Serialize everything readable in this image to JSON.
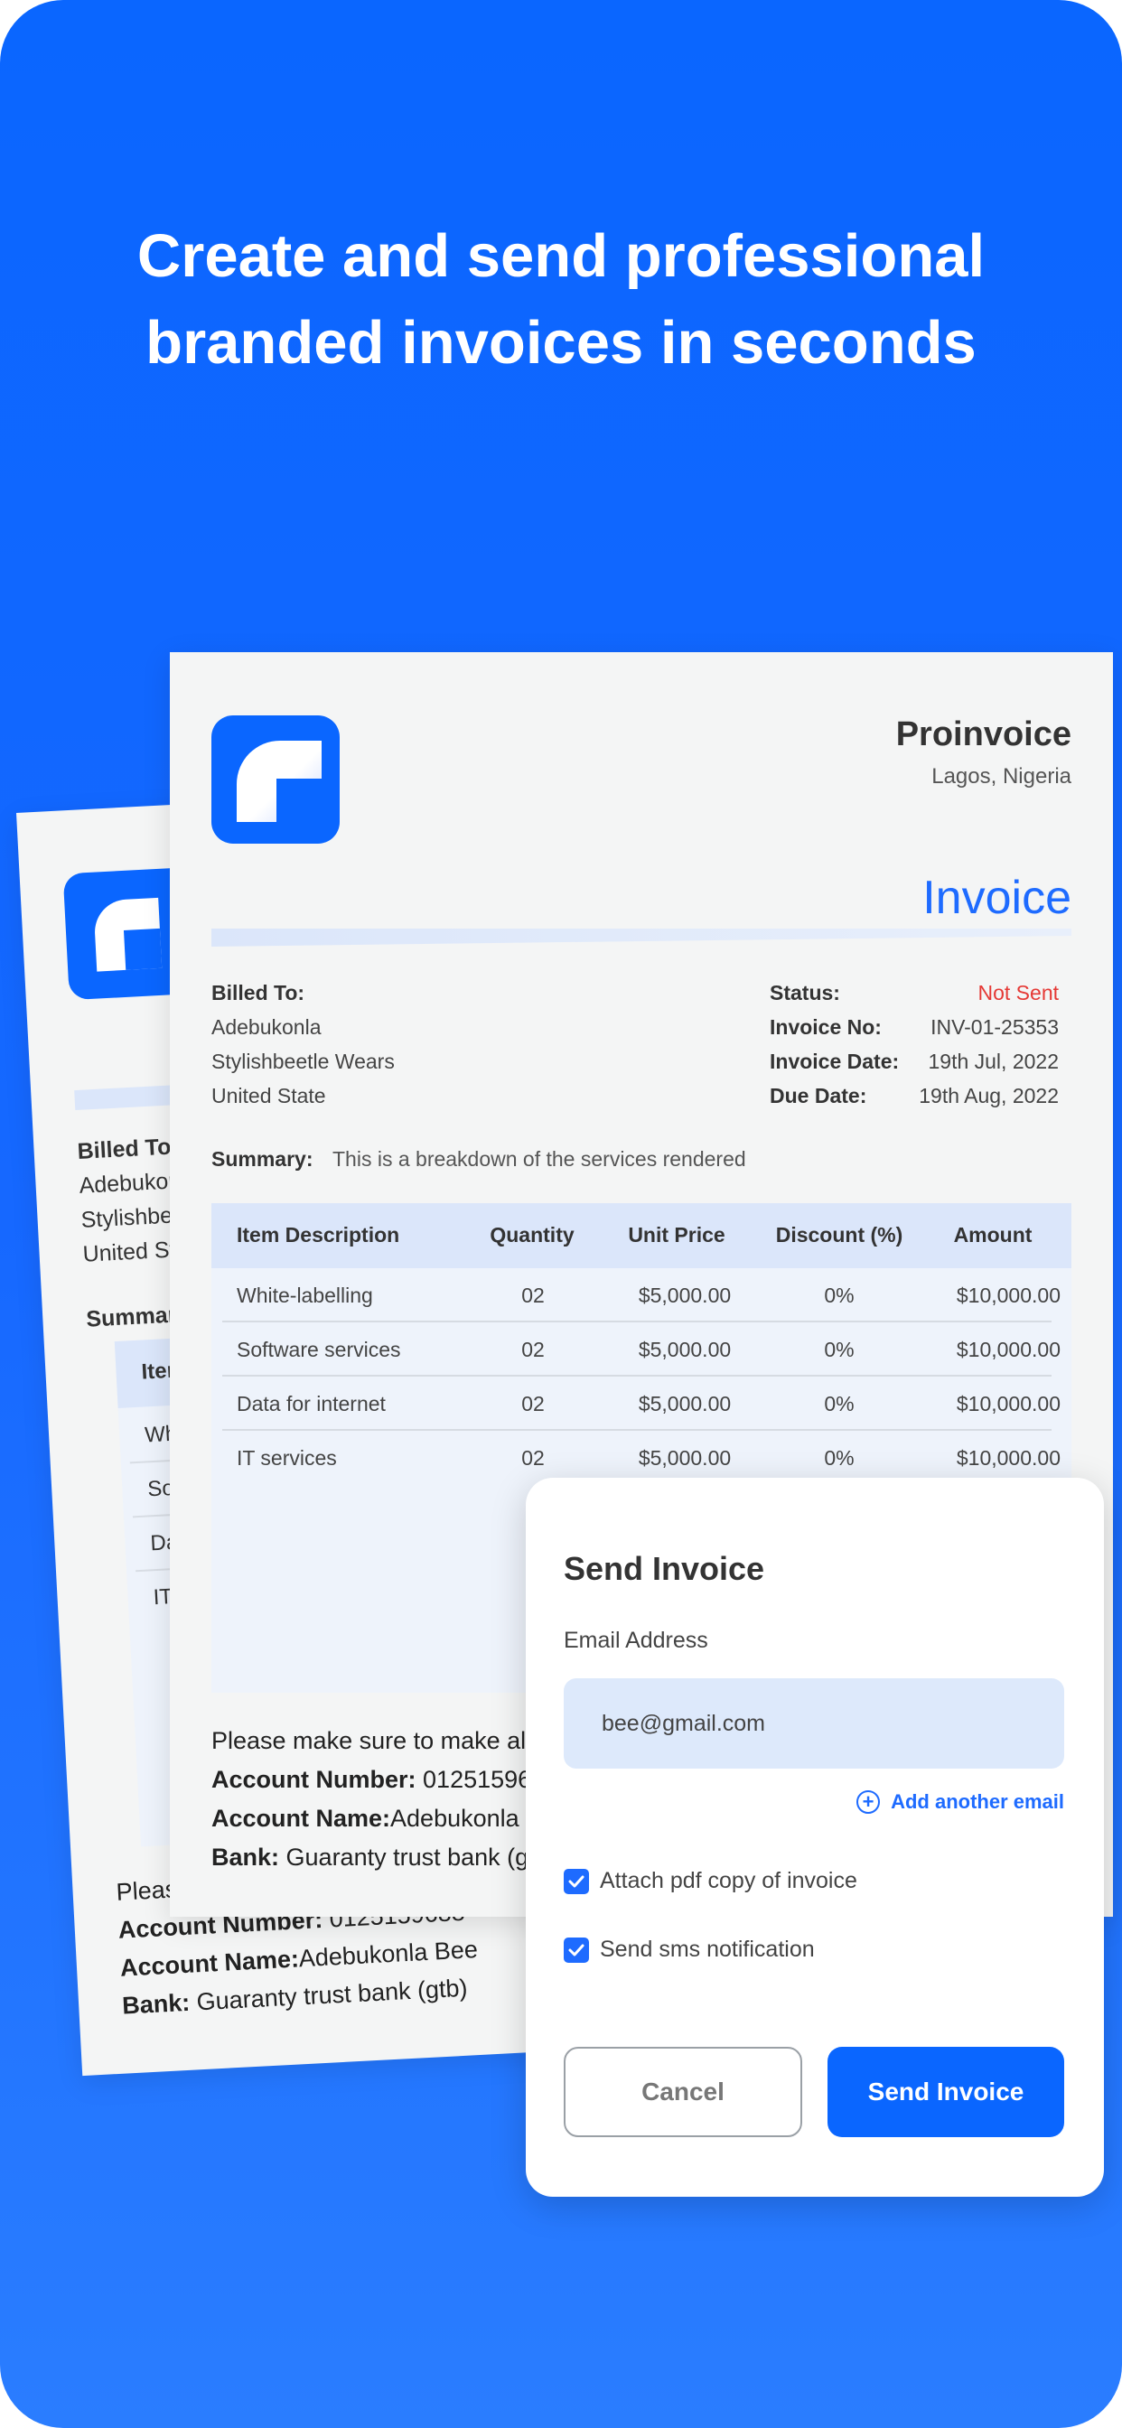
{
  "headline": {
    "line1": "Create and send professional",
    "line2": "branded invoices in seconds"
  },
  "colors": {
    "brand": "#0a66ff",
    "status_not_sent": "#e53935",
    "accent_text": "#1e6bff"
  },
  "invoice": {
    "company_name": "Proinvoice",
    "company_location": "Lagos, Nigeria",
    "title": "Invoice",
    "billed_to_label": "Billed To:",
    "billed_to": [
      "Adebukonla",
      "Stylishbeetle Wears",
      "United State"
    ],
    "meta": [
      {
        "key": "Status:",
        "value": "Not Sent"
      },
      {
        "key": "Invoice No:",
        "value": "INV-01-25353"
      },
      {
        "key": "Invoice Date:",
        "value": "19th Jul, 2022"
      },
      {
        "key": "Due Date:",
        "value": "19th Aug, 2022"
      }
    ],
    "summary_label": "Summary:",
    "summary_text": "This is a breakdown of the services rendered",
    "table": {
      "headers": [
        "Item Description",
        "Quantity",
        "Unit Price",
        "Discount (%)",
        "Amount"
      ],
      "rows": [
        [
          "White-labelling",
          "02",
          "$5,000.00",
          "0%",
          "$10,000.00"
        ],
        [
          "Software services",
          "02",
          "$5,000.00",
          "0%",
          "$10,000.00"
        ],
        [
          "Data for internet",
          "02",
          "$5,000.00",
          "0%",
          "$10,000.00"
        ],
        [
          "IT services",
          "02",
          "$5,000.00",
          "0%",
          "$10,000.00"
        ]
      ]
    },
    "payment_note": "Please make sure to make all",
    "account_number_label": "Account Number:",
    "account_number": "0125159688",
    "account_name_label": "Account Name:",
    "account_name": "Adebukonla Bee",
    "bank_label": "Bank:",
    "bank": "Guaranty trust bank (gtb)"
  },
  "back_invoice": {
    "billed_to_label": "Billed To:",
    "billed_to": [
      "Adebukon",
      "Stylishbee",
      "United St"
    ],
    "summary_label": "Summar",
    "table_header": "Item D",
    "rows": [
      "White",
      "Softw",
      "Data",
      "IT se"
    ],
    "payment_note": "Please make sure to make all p",
    "account_number_label": "Account Number:",
    "account_number": "0125159688",
    "account_name_label": "Account Name:",
    "account_name": "Adebukonla Bee",
    "bank_label": "Bank:",
    "bank": "Guaranty trust bank (gtb)"
  },
  "modal": {
    "title": "Send Invoice",
    "email_label": "Email Address",
    "email_value": "bee@gmail.com",
    "add_email_label": "Add another email",
    "attach_pdf_label": "Attach pdf copy of invoice",
    "attach_pdf_checked": true,
    "sms_label": "Send sms notification",
    "sms_checked": true,
    "cancel_label": "Cancel",
    "send_label": "Send Invoice"
  }
}
